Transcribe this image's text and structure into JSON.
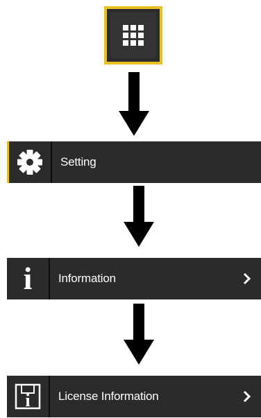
{
  "apps_button": {
    "icon": "apps-grid-icon"
  },
  "menu": {
    "setting": {
      "label": "Setting",
      "icon": "gear-icon"
    },
    "information": {
      "label": "Information",
      "icon": "info-icon"
    },
    "license_information": {
      "label": "License Information",
      "icon": "license-document-icon"
    }
  },
  "colors": {
    "accent": "#e8c021",
    "bar_background": "#2b2b2b",
    "text": "#ffffff",
    "arrow": "#000000"
  }
}
